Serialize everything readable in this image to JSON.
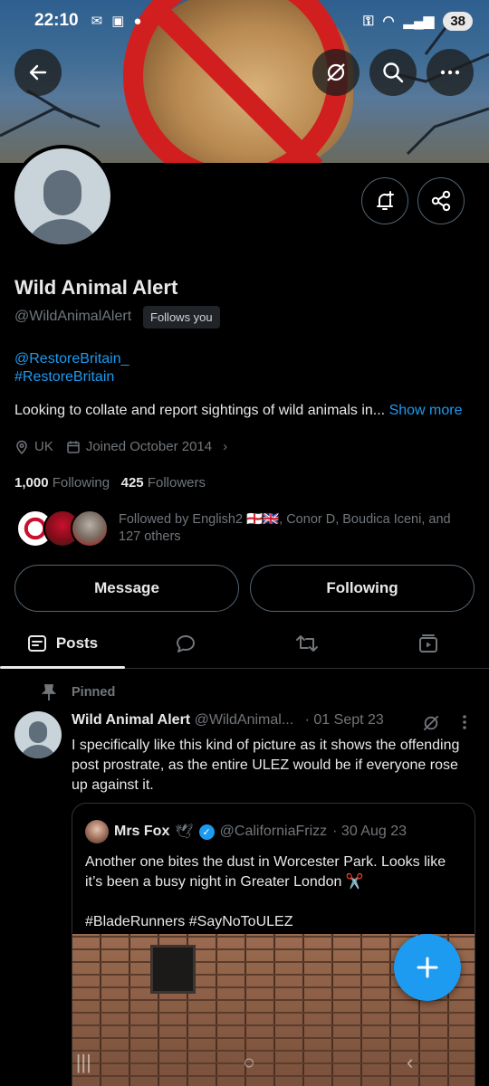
{
  "status_bar": {
    "time": "22:10",
    "battery": "38"
  },
  "profile": {
    "name": "Wild Animal Alert",
    "handle": "@WildAnimalAlert",
    "follows_you": "Follows you",
    "links": [
      "@RestoreBritain_",
      "#RestoreBritain"
    ],
    "bio": "Looking to collate and report sightings of wild animals in...",
    "show_more": "Show more",
    "location": "UK",
    "joined": "Joined October 2014",
    "following_count": "1,000",
    "following_label": "Following",
    "followers_count": "425",
    "followers_label": "Followers",
    "followed_by": "Followed by English2 🏴󠁧󠁢󠁥󠁮󠁧󠁿🇬🇧, Conor D, Boudica Iceni, and 127 others"
  },
  "actions": {
    "message": "Message",
    "following": "Following"
  },
  "tabs": {
    "posts": "Posts"
  },
  "pinned_post": {
    "pinned_label": "Pinned",
    "author": "Wild Animal Alert",
    "handle": "@WildAnimal...",
    "date": "· 01 Sept 23",
    "text": "I specifically like this kind of picture as it shows the offending post prostrate, as the entire ULEZ would be if everyone rose up against it."
  },
  "quoted_post": {
    "author": "Mrs Fox",
    "emoji": "🕊",
    "handle": "@CaliforniaFrizz",
    "date": "· 30 Aug 23",
    "text": "Another one bites the dust in Worcester Park. Looks like it’s been a busy night in Greater London ✂️",
    "hashtags": "#BladeRunners #SayNoToULEZ"
  },
  "colors": {
    "accent": "#1d9bf0",
    "background": "#000000",
    "muted": "#71767b",
    "border": "#536471",
    "ban_red": "#d11f1f"
  }
}
